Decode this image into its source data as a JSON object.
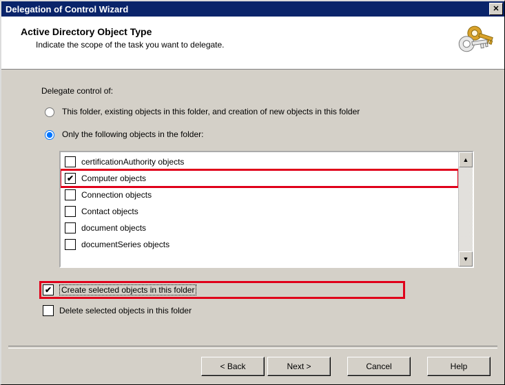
{
  "window": {
    "title": "Delegation of Control Wizard"
  },
  "header": {
    "title": "Active Directory Object Type",
    "subtitle": "Indicate the scope of the task you want to delegate."
  },
  "body": {
    "prompt": "Delegate control of:",
    "radio1": "This folder, existing objects in this folder, and creation of new objects in this folder",
    "radio2": "Only the following objects in the folder:"
  },
  "listbox": {
    "items": [
      {
        "label": "certificationAuthority objects",
        "checked": false,
        "highlight": false
      },
      {
        "label": "Computer objects",
        "checked": true,
        "highlight": true
      },
      {
        "label": "Connection objects",
        "checked": false,
        "highlight": false
      },
      {
        "label": "Contact objects",
        "checked": false,
        "highlight": false
      },
      {
        "label": "document objects",
        "checked": false,
        "highlight": false
      },
      {
        "label": "documentSeries objects",
        "checked": false,
        "highlight": false
      }
    ]
  },
  "options": {
    "create": {
      "label": "Create selected objects in this folder",
      "checked": true,
      "highlight": true
    },
    "delete": {
      "label": "Delete selected objects in this folder",
      "checked": false,
      "highlight": false
    }
  },
  "footer": {
    "back": "< Back",
    "next": "Next >",
    "cancel": "Cancel",
    "help": "Help"
  },
  "icons": {
    "close": "✕",
    "up": "▲",
    "down": "▼",
    "check": "✔"
  }
}
